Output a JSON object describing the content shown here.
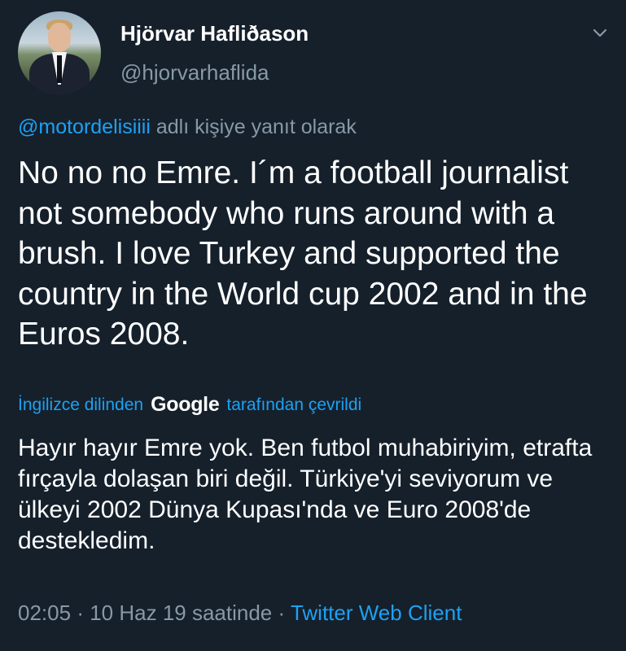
{
  "author": {
    "name": "Hjörvar Hafliðason",
    "handle": "@hjorvarhaflida"
  },
  "reply": {
    "mention": "@motordelisiiii",
    "suffix": "adlı kişiye yanıt olarak"
  },
  "tweet": {
    "text": "No no no Emre. I´m a football journalist not somebody who runs around with a brush. I love Turkey and supported the country in the World cup 2002 and in the Euros 2008."
  },
  "translation": {
    "prefix": "İngilizce dilinden",
    "provider": "Google",
    "suffix": "tarafından çevrildi",
    "text": "Hayır hayır Emre yok. Ben futbol muhabiriyim, etrafta fırçayla dolaşan biri değil. Türkiye'yi seviyorum ve ülkeyi 2002 Dünya Kupası'nda ve Euro 2008'de destekledim."
  },
  "meta": {
    "time": "02:05",
    "sep1": "·",
    "date": "10 Haz 19 saatinde",
    "sep2": "·",
    "client": "Twitter Web Client"
  },
  "icons": {
    "menu": "chevron-down-icon"
  },
  "colors": {
    "background": "#15202b",
    "accent": "#1da1f2",
    "muted": "#8899a6",
    "text": "#ffffff"
  }
}
